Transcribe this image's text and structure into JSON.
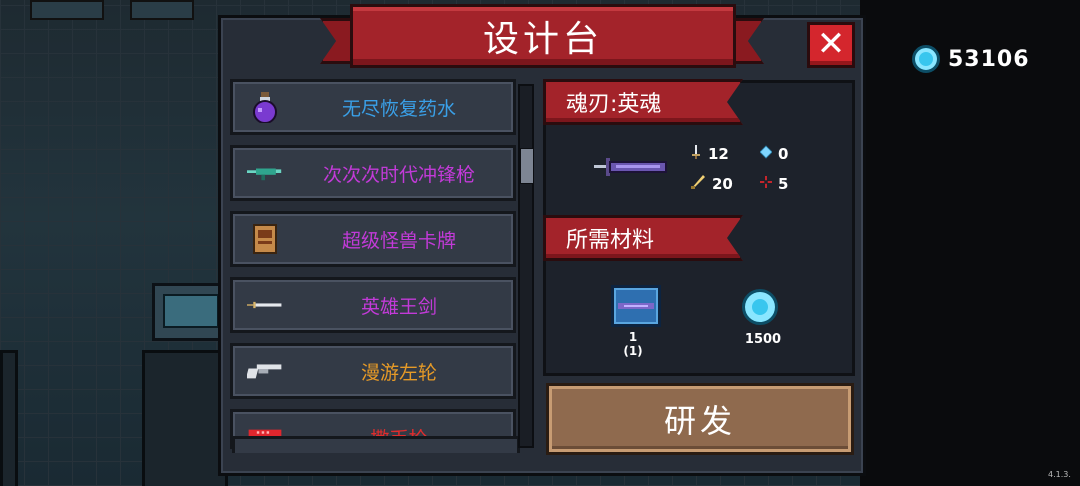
{
  "title": "设计台",
  "close_label": "✕",
  "gems": {
    "count": "53106",
    "icon": "gem-icon",
    "color": "#38c6ee"
  },
  "items": [
    {
      "label": "无尽恢复药水",
      "icon": "potion-icon",
      "color": "#3aa0e8"
    },
    {
      "label": "次次次时代冲锋枪",
      "icon": "smg-icon",
      "color": "#c23ad8"
    },
    {
      "label": "超级怪兽卡牌",
      "icon": "card-icon",
      "color": "#c23ad8"
    },
    {
      "label": "英雄王剑",
      "icon": "sword-icon",
      "color": "#c23ad8"
    },
    {
      "label": "漫游左轮",
      "icon": "revolver-icon",
      "color": "#e69a27"
    },
    {
      "label": "撒币枪",
      "icon": "coin-gun-icon",
      "color": "#e02d2d"
    }
  ],
  "weapon": {
    "name": "魂刃:英魂",
    "stats": {
      "damage": "12",
      "energy": "0",
      "crit": "20",
      "accuracy": "5"
    }
  },
  "materials": {
    "header": "所需材料",
    "items": [
      {
        "icon": "blade-material-icon",
        "line1": "1",
        "line2": "(1)"
      },
      {
        "icon": "gem-icon",
        "line1": "1500"
      }
    ]
  },
  "research_label": "研发",
  "version": "4.1.3."
}
